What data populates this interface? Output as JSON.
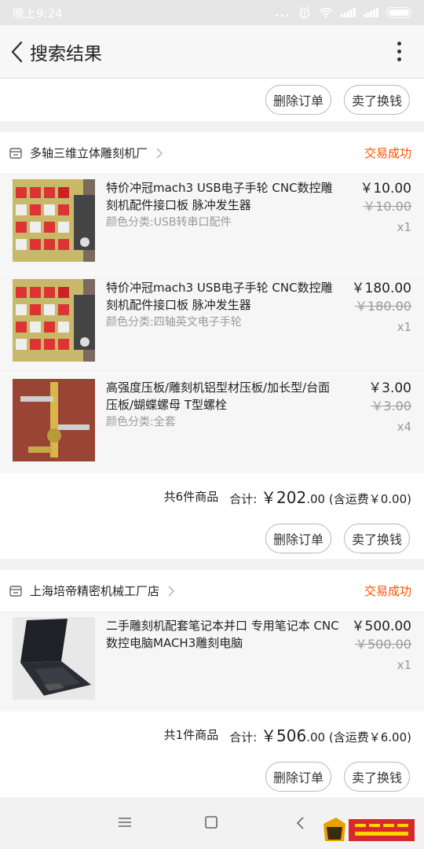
{
  "status_bar": {
    "time": "晚上9:24",
    "dots": "..."
  },
  "header": {
    "title": "搜索结果"
  },
  "colors": {
    "accent": "#ff5000"
  },
  "top_actions": {
    "delete": "删除订单",
    "sell": "卖了换钱"
  },
  "orders": [
    {
      "shop": "多轴三维立体雕刻机厂",
      "status": "交易成功",
      "items": [
        {
          "title": "特价冲冠mach3 USB电子手轮 CNC数控雕刻机配件接口板 脉冲发生器",
          "variant": "颜色分类:USB转串口配件",
          "price": "￥10.00",
          "orig": "￥10.00",
          "qty": "x1"
        },
        {
          "title": "特价冲冠mach3 USB电子手轮 CNC数控雕刻机配件接口板 脉冲发生器",
          "variant": "颜色分类:四轴英文电子手轮",
          "price": "￥180.00",
          "orig": "￥180.00",
          "qty": "x1"
        },
        {
          "title": "高强度压板/雕刻机铝型材压板/加长型/台面压板/蝴蝶螺母 T型螺栓",
          "variant": "颜色分类:全套",
          "price": "￥3.00",
          "orig": "￥3.00",
          "qty": "x4"
        }
      ],
      "summary": {
        "count": "共6件商品",
        "label": "合计:",
        "total_int": "￥202",
        "total_dec": ".00",
        "shipping": "(含运费￥0.00)"
      },
      "actions": {
        "delete": "删除订单",
        "sell": "卖了换钱"
      }
    },
    {
      "shop": "上海培帝精密机械工厂店",
      "status": "交易成功",
      "items": [
        {
          "title": "二手雕刻机配套笔记本并口 专用笔记本 CNC数控电脑MACH3雕刻电脑",
          "variant": "",
          "price": "￥500.00",
          "orig": "￥500.00",
          "qty": "x1"
        }
      ],
      "summary": {
        "count": "共1件商品",
        "label": "合计:",
        "total_int": "￥506",
        "total_dec": ".00",
        "shipping": "(含运费￥6.00)"
      },
      "actions": {
        "delete": "删除订单",
        "sell": "卖了换钱"
      }
    }
  ]
}
